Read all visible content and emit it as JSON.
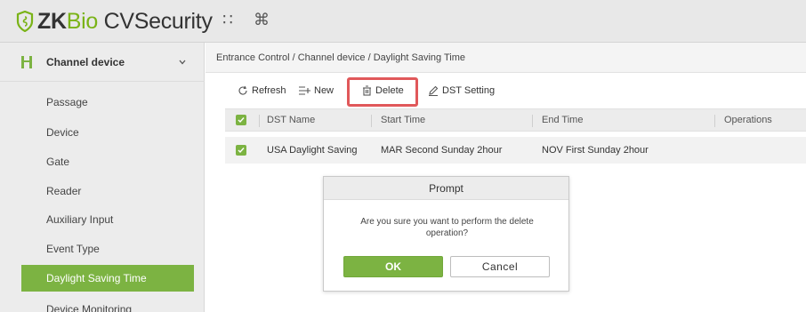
{
  "app": {
    "logo_prefix": "ZK",
    "logo_bio": "Bio",
    "logo_suffix": " CVSecurity",
    "accent_color": "#7cb342",
    "highlight_color": "#e0585a"
  },
  "topbar": {
    "icons": [
      "grid-menu-icon",
      "command-icon"
    ],
    "grid_glyph": "∷",
    "command_glyph": "⌘"
  },
  "sidebar": {
    "module_label": "Channel device",
    "items": [
      {
        "label": "Passage"
      },
      {
        "label": "Device"
      },
      {
        "label": "Gate"
      },
      {
        "label": "Reader"
      },
      {
        "label": "Auxiliary Input"
      },
      {
        "label": "Event Type"
      },
      {
        "label": "Daylight Saving Time",
        "active": true
      },
      {
        "label": "Device Monitoring"
      }
    ]
  },
  "breadcrumb": "Entrance Control / Channel device / Daylight Saving Time",
  "toolbar": {
    "refresh": "Refresh",
    "new": "New",
    "delete": "Delete",
    "dst_setting": "DST Setting"
  },
  "table": {
    "columns": [
      "DST Name",
      "Start Time",
      "End Time",
      "Operations"
    ],
    "rows": [
      {
        "name": "USA Daylight Saving",
        "start": "MAR Second Sunday 2hour",
        "end": "NOV First Sunday 2hour",
        "checked": true
      }
    ]
  },
  "dialog": {
    "title": "Prompt",
    "message": "Are you sure you want to perform the delete operation?",
    "ok": "OK",
    "cancel": "Cancel"
  }
}
